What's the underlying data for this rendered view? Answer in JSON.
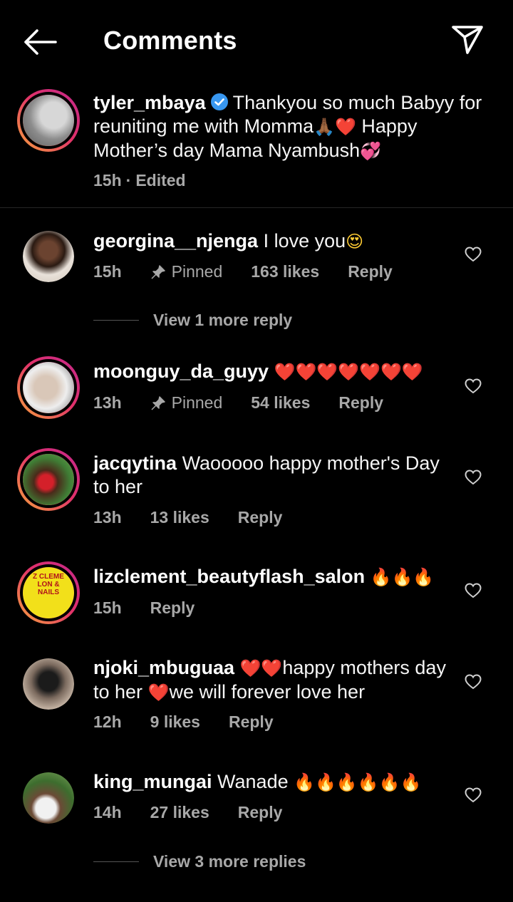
{
  "header": {
    "title": "Comments"
  },
  "caption": {
    "username": "tyler_mbaya",
    "text_a": "Thankyou so much Babyy for reuniting me with Momma",
    "text_b": "Happy Mother’s day Mama Nyambush",
    "time": "15h",
    "edited": "Edited",
    "emoji_1": "🙏🏾",
    "emoji_2": "❤️",
    "emoji_3": "💞"
  },
  "comments": [
    {
      "username": "georgina__njenga",
      "text": "I love you",
      "emoji": "😍",
      "time": "15h",
      "pinned": "Pinned",
      "likes": "163 likes",
      "reply": "Reply"
    },
    {
      "username": "moonguy_da_guyy",
      "text": "",
      "emoji": "❤️❤️❤️❤️❤️❤️❤️",
      "time": "13h",
      "pinned": "Pinned",
      "likes": "54 likes",
      "reply": "Reply"
    },
    {
      "username": "jacqytina",
      "text": "Waooooo happy mother's Day to her",
      "time": "13h",
      "likes": "13 likes",
      "reply": "Reply"
    },
    {
      "username": "lizclement_beautyflash_salon",
      "emoji": "🔥🔥🔥",
      "time": "15h",
      "reply": "Reply",
      "avatar_text": "Z CLEME LON & NAILS"
    },
    {
      "username": "njoki_mbuguaa",
      "emoji_a": "❤️❤️",
      "text_a": "happy mothers day to her",
      "emoji_b": "❤️",
      "text_b": "we will forever love her",
      "time": "12h",
      "likes": "9 likes",
      "reply": "Reply"
    },
    {
      "username": "king_mungai",
      "text": "Wanade",
      "emoji": "🔥🔥🔥🔥🔥🔥",
      "time": "14h",
      "likes": "27 likes",
      "reply": "Reply"
    }
  ],
  "view_more": {
    "first": "View 1 more reply",
    "second": "View 3 more replies"
  },
  "icons": {
    "back": "arrow-left-icon",
    "share": "paper-plane-icon",
    "verified": "verified-badge-icon",
    "pin": "pin-icon",
    "like": "heart-outline-icon"
  },
  "colors": {
    "background": "#000000",
    "verified": "#3897f0",
    "muted": "#a8a8a8"
  }
}
